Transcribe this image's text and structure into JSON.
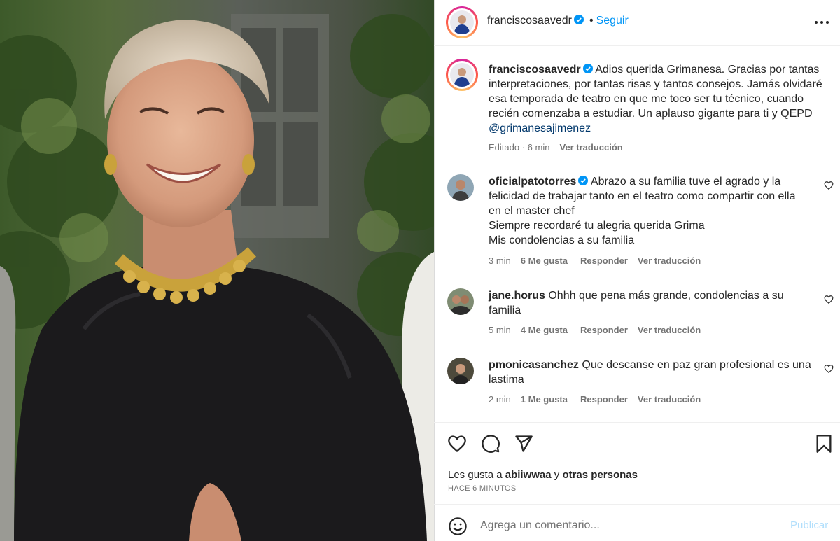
{
  "post": {
    "username": "franciscosaavedr",
    "follow_label": "Seguir",
    "dot": "•"
  },
  "caption": {
    "username": "franciscosaavedr",
    "text": "Adios querida Grimanesa. Gracias por tantas interpretaciones, por tantas risas y tantos consejos. Jamás olvidaré esa temporada de teatro en que me toco ser tu técnico, cuando recién comenzaba a estudiar. Un aplauso gigante para ti y QEPD",
    "mention": "@grimanesajimenez",
    "edited": "Editado · 6 min",
    "translate": "Ver traducción"
  },
  "comments": [
    {
      "username": "oficialpatotorres",
      "verified": true,
      "text_lines": [
        "Abrazo a su familia tuve el agrado y la",
        "felicidad de trabajar tanto en el teatro como compartir con ella",
        "en el master chef",
        "Siempre recordaré tu alegria querida Grima",
        "Mis condolencias a su familia"
      ],
      "time": "3 min",
      "likes": "6 Me gusta",
      "reply": "Responder",
      "translate": "Ver traducción"
    },
    {
      "username": "jane.horus",
      "verified": false,
      "text_lines": [
        "Ohhh que pena más grande, condolencias a su",
        "familia"
      ],
      "time": "5 min",
      "likes": "4 Me gusta",
      "reply": "Responder",
      "translate": "Ver traducción"
    },
    {
      "username": "pmonicasanchez",
      "verified": false,
      "text_lines": [
        "Que descanse en paz gran profesional es una",
        "lastima"
      ],
      "time": "2 min",
      "likes": "1 Me gusta",
      "reply": "Responder",
      "translate": "Ver traducción"
    }
  ],
  "likes_line": {
    "prefix": "Les gusta a",
    "user": "abiiwwaa",
    "middle": "y",
    "others": "otras personas"
  },
  "posted_ago": "HACE 6 MINUTOS",
  "composer": {
    "placeholder": "Agrega un comentario...",
    "publish": "Publicar"
  },
  "icons": [
    "verified-badge-icon",
    "more-options-icon",
    "heart-icon",
    "comment-icon",
    "share-icon",
    "bookmark-icon",
    "emoji-icon"
  ],
  "colors": {
    "accent": "#0095f6",
    "mention": "#00376b",
    "muted": "#737373"
  }
}
